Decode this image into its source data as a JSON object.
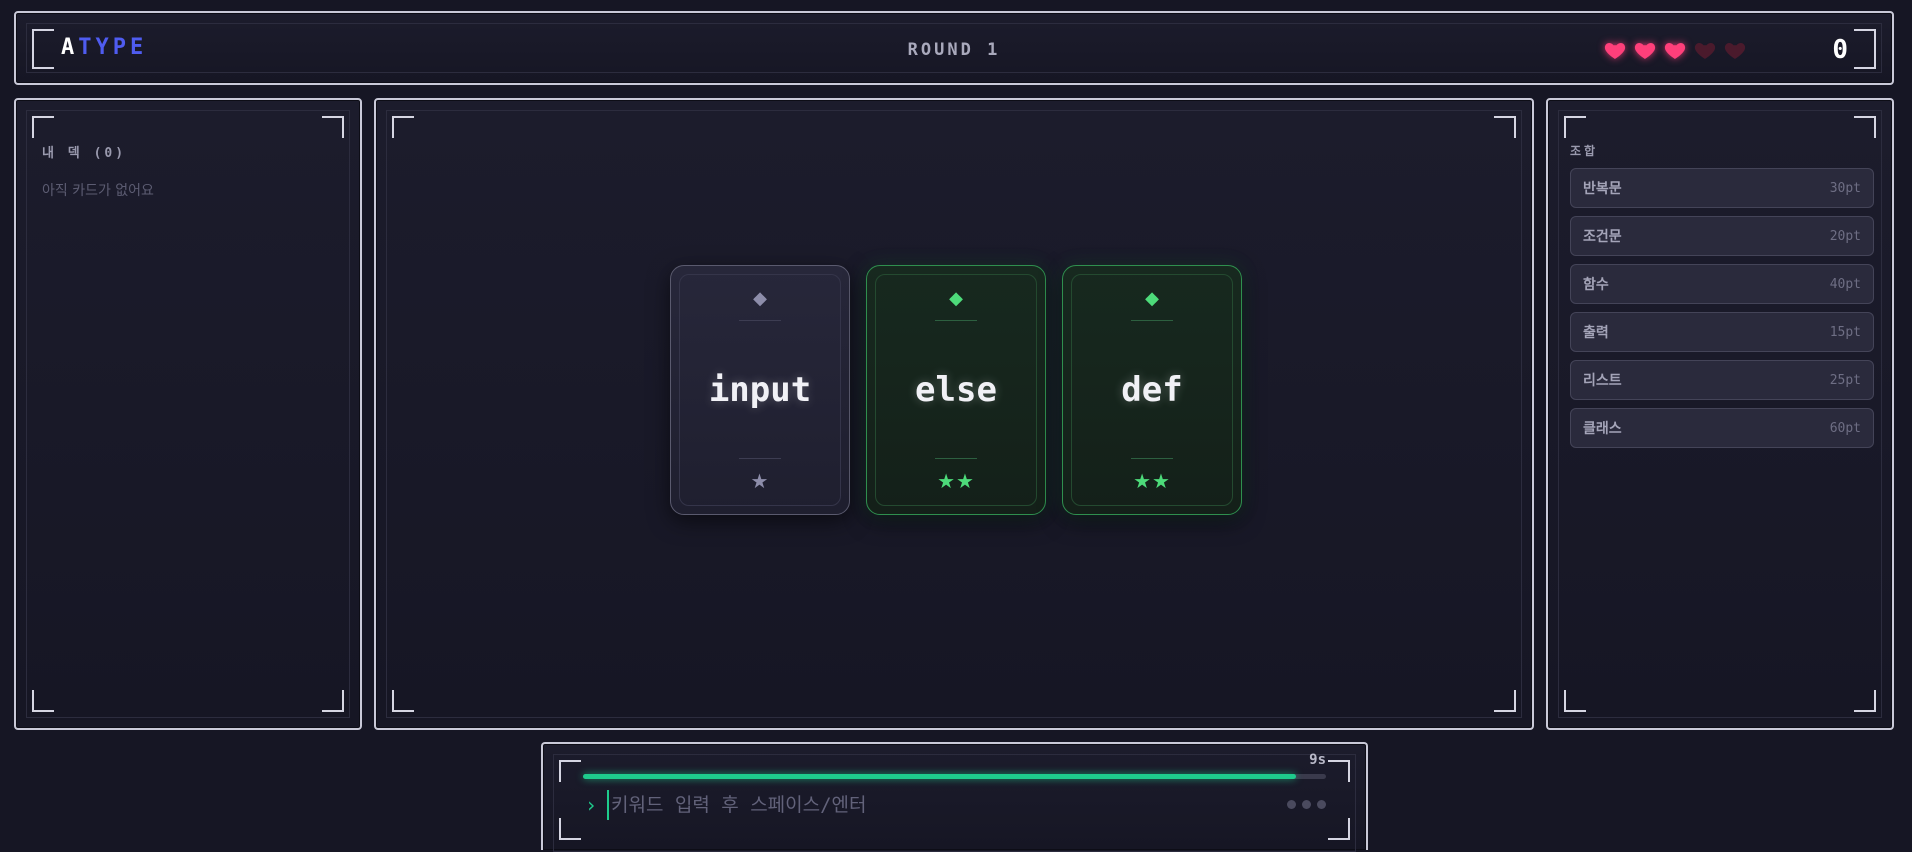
{
  "header": {
    "logo_first": "A",
    "logo_rest": "TYPE",
    "round": "ROUND 1",
    "lives": {
      "full": 3,
      "max": 5
    },
    "score": "0"
  },
  "deck": {
    "title": "내 덱 (0)",
    "empty_text": "아직 카드가 없어요"
  },
  "hand": {
    "cards": [
      {
        "word": "input",
        "gem": "◆",
        "stars": "★",
        "rarity": "common"
      },
      {
        "word": "else",
        "gem": "◆",
        "stars": "★★",
        "rarity": "green"
      },
      {
        "word": "def",
        "gem": "◆",
        "stars": "★★",
        "rarity": "green"
      }
    ]
  },
  "combos": {
    "title": "조합",
    "items": [
      {
        "name": "반복문",
        "points": "30pt"
      },
      {
        "name": "조건문",
        "points": "20pt"
      },
      {
        "name": "함수",
        "points": "40pt"
      },
      {
        "name": "출력",
        "points": "15pt"
      },
      {
        "name": "리스트",
        "points": "25pt"
      },
      {
        "name": "클래스",
        "points": "60pt"
      }
    ]
  },
  "input": {
    "timer_label": "9s",
    "timer_fraction": 0.96,
    "prompt": "›",
    "placeholder": "키워드 입력 후 스페이스/엔터",
    "value": ""
  },
  "colors": {
    "accent": "#1ecb8c",
    "logo_blue": "#4f5cf0",
    "heart_full": "#ff3f7a",
    "heart_empty": "#4a1a2c",
    "card_green": "#4ddb7a"
  }
}
